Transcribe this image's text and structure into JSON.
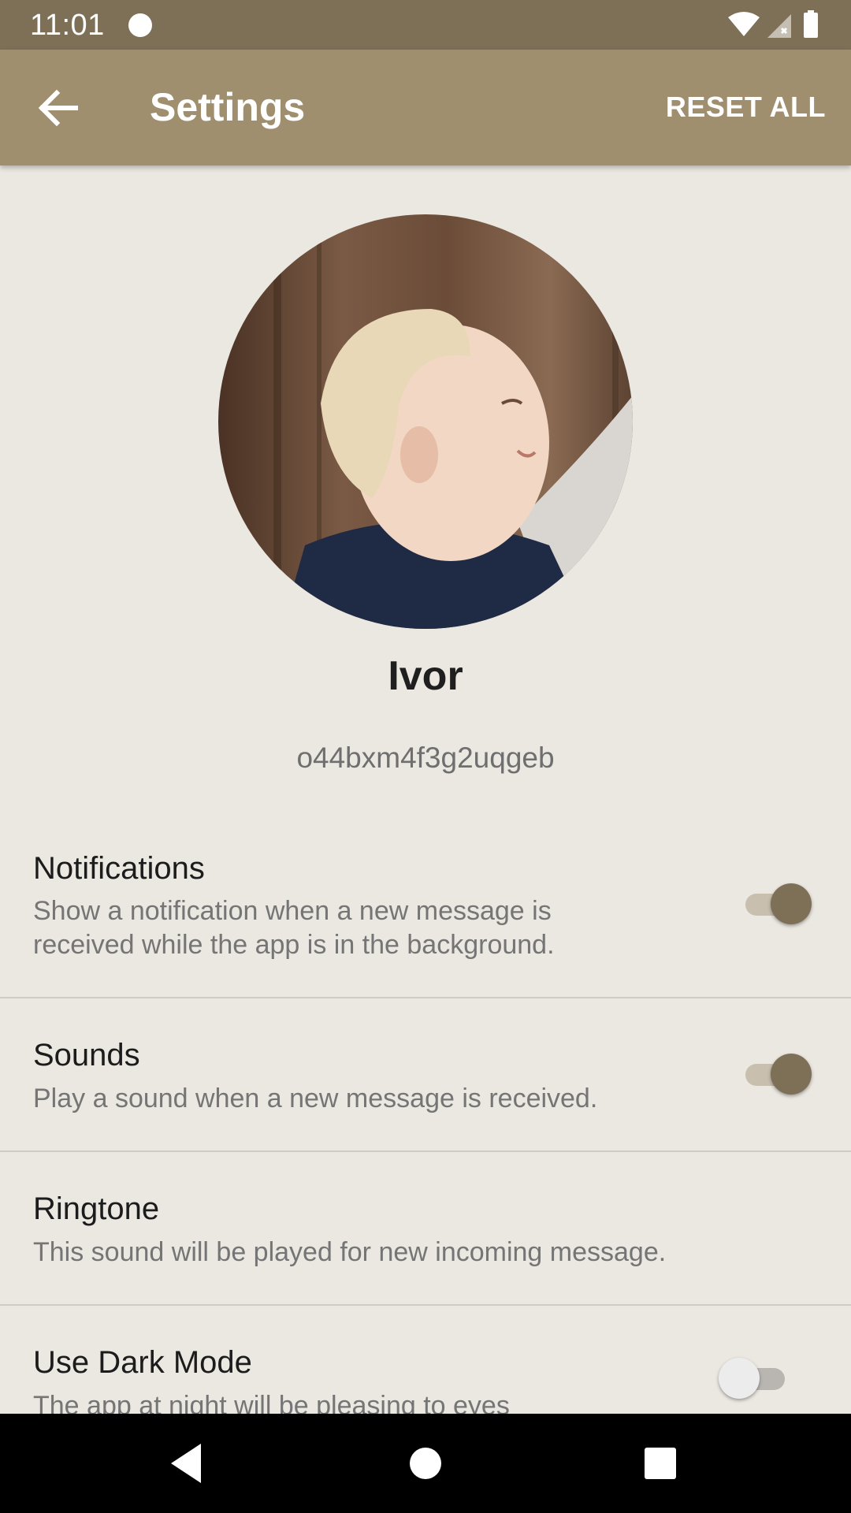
{
  "status_bar": {
    "time": "11:01",
    "icons": [
      "notification-dot-icon",
      "wifi-icon",
      "cell-signal-icon",
      "battery-icon"
    ]
  },
  "app_bar": {
    "back_icon": "arrow-left-icon",
    "title": "Settings",
    "reset_label": "RESET ALL"
  },
  "profile": {
    "name": "Ivor",
    "id": "o44bxm4f3g2uqgeb"
  },
  "settings": [
    {
      "title": "Notifications",
      "description": "Show a notification when a new message is received while the app is in the background.",
      "toggle": true
    },
    {
      "title": "Sounds",
      "description": "Play a sound when a new message is received.",
      "toggle": true
    },
    {
      "title": "Ringtone",
      "description": "This sound will be played for new incoming message."
    },
    {
      "title": "Use Dark Mode",
      "description": "The app at night will be pleasing to eyes",
      "toggle": false
    }
  ],
  "nav_bar": {
    "buttons": [
      "back-triangle-icon",
      "home-circle-icon",
      "recents-square-icon"
    ]
  },
  "colors": {
    "status_bar": "#7e7057",
    "app_bar": "#a08f6e",
    "background": "#ebe7e1",
    "accent": "#7e7057"
  }
}
